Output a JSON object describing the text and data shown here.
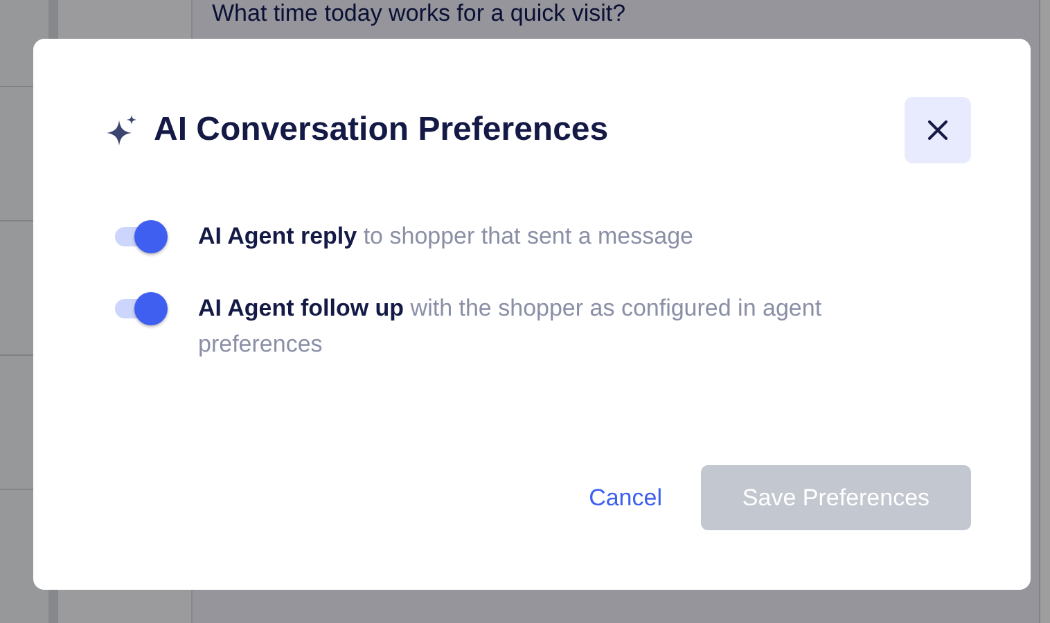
{
  "background": {
    "message": {
      "text": "What time today works for a quick visit?"
    }
  },
  "dialog": {
    "title": "AI Conversation Preferences",
    "options": [
      {
        "text": "**AI Agent reply** to shopper that sent a message",
        "on": true
      },
      {
        "text": "**AI Agent follow up** with the shopper as configured in agent preferences",
        "on": true
      }
    ],
    "buttons": [
      {
        "label": "Cancel",
        "kind": "link"
      },
      {
        "label": "Save Preferences",
        "kind": "primary",
        "disabled": true
      }
    ]
  }
}
